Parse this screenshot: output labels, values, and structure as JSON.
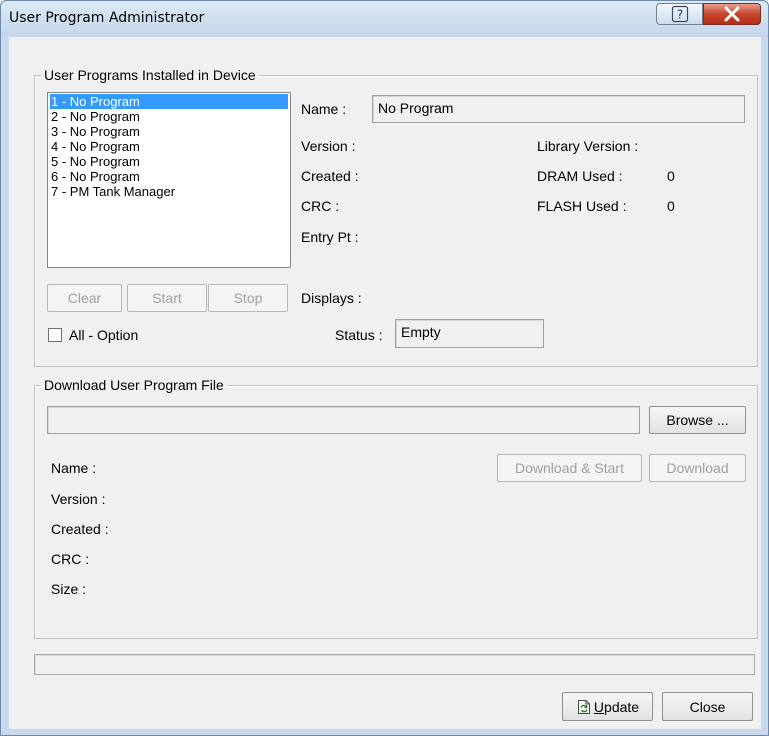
{
  "window": {
    "title": "User Program Administrator",
    "help_glyph": "?",
    "close_glyph": "X"
  },
  "installed": {
    "legend": "User Programs Installed in Device",
    "programs": [
      "1 - No Program",
      "2 - No Program",
      "3 - No Program",
      "4 - No Program",
      "5 - No Program",
      "6 - No Program",
      "7 - PM Tank Manager"
    ],
    "selected_index": 0,
    "name_label": "Name :",
    "name_value": "No Program",
    "version_label": "Version :",
    "created_label": "Created :",
    "crc_label": "CRC :",
    "entry_pt_label": "Entry Pt :",
    "library_version_label": "Library Version :",
    "dram_used_label": "DRAM Used :",
    "dram_used_value": "0",
    "flash_used_label": "FLASH Used :",
    "flash_used_value": "0",
    "displays_label": "Displays :",
    "status_label": "Status :",
    "status_value": "Empty",
    "clear_label": "Clear",
    "start_label": "Start",
    "stop_label": "Stop",
    "all_option_label": "All - Option"
  },
  "download": {
    "legend": "Download User Program File",
    "file_path": "",
    "browse_label": "Browse ...",
    "download_start_label": "Download & Start",
    "download_label": "Download",
    "name_label": "Name :",
    "version_label": "Version :",
    "created_label": "Created :",
    "crc_label": "CRC :",
    "size_label": "Size :"
  },
  "footer": {
    "update_label": "Update",
    "update_mnemonic": "U",
    "close_label": "Close"
  }
}
